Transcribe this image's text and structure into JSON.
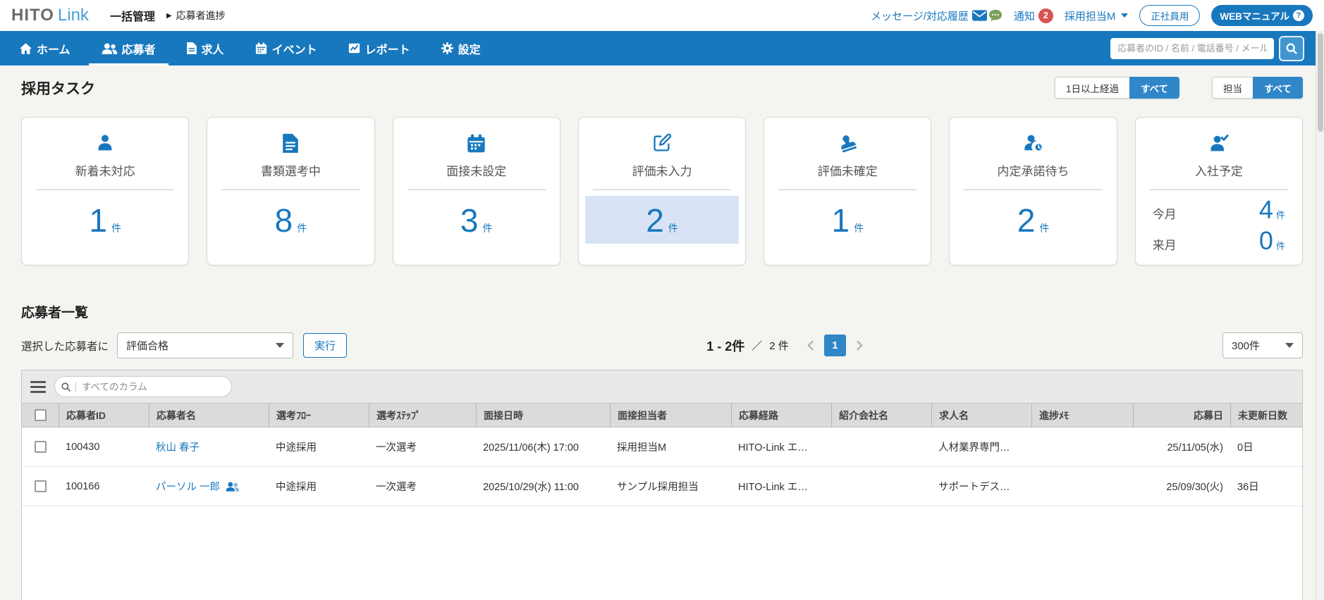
{
  "header": {
    "logo_primary": "HITO",
    "logo_secondary": "Link",
    "breadcrumb_root": "一括管理",
    "breadcrumb_separator": "▶",
    "breadcrumb_current": "応募者進捗",
    "messages_label": "メッセージ/対応履歴",
    "notifications_label": "通知",
    "notification_count": "2",
    "user_name": "採用担当M",
    "account_type": "正社員用",
    "manual_label": "WEBマニュアル"
  },
  "nav": {
    "items": [
      {
        "label": "ホーム",
        "active": false
      },
      {
        "label": "応募者",
        "active": true
      },
      {
        "label": "求人",
        "active": false
      },
      {
        "label": "イベント",
        "active": false
      },
      {
        "label": "レポート",
        "active": false
      },
      {
        "label": "設定",
        "active": false
      }
    ],
    "search_placeholder": "応募者のID / 名前 / 電話番号 / メール"
  },
  "tasks": {
    "title": "採用タスク",
    "filter_groups": [
      {
        "options": [
          "1日以上経過",
          "すべて"
        ],
        "active_index": 1
      },
      {
        "options": [
          "担当",
          "すべて"
        ],
        "active_index": 1
      }
    ],
    "cards": [
      {
        "label": "新着未対応",
        "count": "1",
        "unit": "件"
      },
      {
        "label": "書類選考中",
        "count": "8",
        "unit": "件"
      },
      {
        "label": "面接未設定",
        "count": "3",
        "unit": "件"
      },
      {
        "label": "評価未入力",
        "count": "2",
        "unit": "件",
        "highlighted": true
      },
      {
        "label": "評価未確定",
        "count": "1",
        "unit": "件"
      },
      {
        "label": "内定承諾待ち",
        "count": "2",
        "unit": "件"
      },
      {
        "label": "入社予定",
        "rows": [
          {
            "label": "今月",
            "count": "4",
            "unit": "件"
          },
          {
            "label": "来月",
            "count": "0",
            "unit": "件"
          }
        ]
      }
    ]
  },
  "list": {
    "title": "応募者一覧",
    "action_label": "選択した応募者に",
    "action_value": "評価合格",
    "execute_label": "実行",
    "pagination": {
      "range": "1 - 2件",
      "separator": "／",
      "total": "2 件",
      "page": "1"
    },
    "page_size": "300件",
    "toolbar_placeholder": "すべてのカラム",
    "columns": [
      "応募者ID",
      "応募者名",
      "選考ﾌﾛｰ",
      "選考ｽﾃｯﾌﾟ",
      "面接日時",
      "面接担当者",
      "応募経路",
      "紹介会社名",
      "求人名",
      "進捗ﾒﾓ",
      "応募日",
      "未更新日数"
    ],
    "rows": [
      {
        "id": "100430",
        "name": "秋山 春子",
        "flow": "中途採用",
        "step": "一次選考",
        "interview_at": "2025/11/06(木) 17:00",
        "interviewer": "採用担当M",
        "route": "HITO-Link エ…",
        "agency": "",
        "job": "人材業界専門…",
        "memo": "",
        "applied": "25/11/05(水)",
        "stale_days": "0日"
      },
      {
        "id": "100166",
        "name": "パーソル 一郎",
        "flow": "中途採用",
        "step": "一次選考",
        "interview_at": "2025/10/29(水) 11:00",
        "interviewer": "サンプル採用担当",
        "route": "HITO-Link エ…",
        "agency": "",
        "job": "サポートデス…",
        "memo": "",
        "applied": "25/09/30(火)",
        "stale_days": "36日"
      }
    ]
  }
}
